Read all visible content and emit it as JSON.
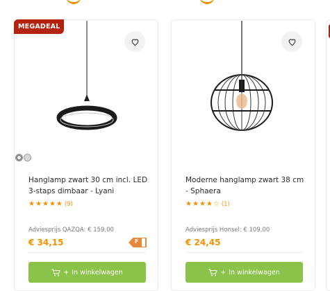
{
  "colors": {
    "accent": "#f39200",
    "badge": "#b3230f",
    "button": "#8bc34a"
  },
  "products": [
    {
      "badge": "MEGADEAL",
      "title": "Hanglamp zwart 30 cm incl. LED 3-staps dimbaar - Lyani",
      "rating": 5,
      "reviews": "(9)",
      "advice": "Adviesprijs QAZQA: € 159,00",
      "price": "€ 34,15",
      "discount_tag": "F",
      "button": "In winkelwagen"
    },
    {
      "title": "Moderne hanglamp zwart 38 cm - Sphaera",
      "rating": 4,
      "reviews": "(1)",
      "advice": "Adviesprijs Honsel: € 109,00",
      "price": "€ 24,45",
      "button": "In winkelwagen"
    }
  ]
}
